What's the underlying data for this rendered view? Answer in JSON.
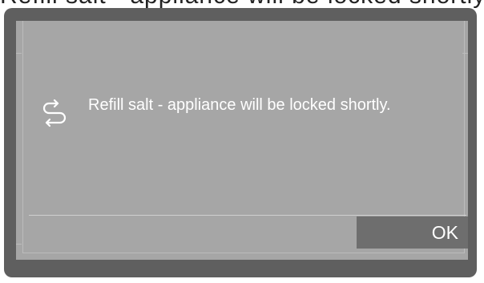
{
  "header_caption": "Refill salt - appliance will be locked shortly",
  "dialog": {
    "icon": "refill-salt-icon",
    "message": "Refill salt - appliance will be locked shortly.",
    "ok_label": "OK"
  },
  "colors": {
    "frame": "#5f5f5f",
    "screen": "#a6a6a6",
    "button": "#6e6e6e",
    "text": "#ffffff"
  }
}
